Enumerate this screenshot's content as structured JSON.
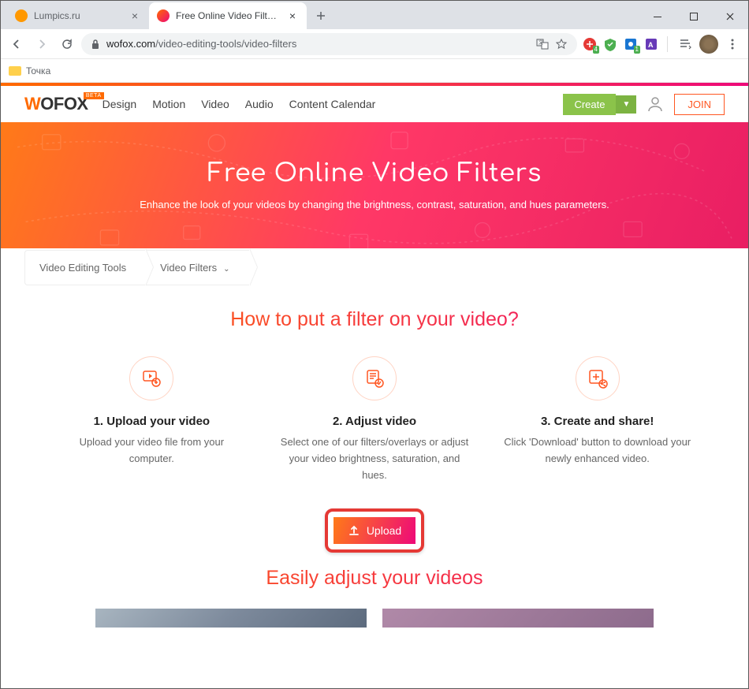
{
  "browser": {
    "tabs": [
      {
        "title": "Lumpics.ru",
        "active": false
      },
      {
        "title": "Free Online Video Filters | WoFo...",
        "active": true
      }
    ],
    "url_prefix": "wofox.com",
    "url_path": "/video-editing-tools/video-filters",
    "bookmark": "Точка"
  },
  "siteNav": {
    "logo_w": "W",
    "logo_rest": "OFOX",
    "logo_beta": "BETA",
    "items": [
      "Design",
      "Motion",
      "Video",
      "Audio",
      "Content Calendar"
    ],
    "create": "Create",
    "join": "JOIN"
  },
  "hero": {
    "title": "Free Online Video Filters",
    "subtitle": "Enhance the look of your videos by changing the brightness, contrast, saturation, and hues parameters."
  },
  "breadcrumb": {
    "items": [
      "Video Editing Tools",
      "Video Filters"
    ]
  },
  "howto": {
    "title": "How to put a filter on your video?",
    "steps": [
      {
        "title": "1. Upload your video",
        "desc": "Upload your video file from your computer."
      },
      {
        "title": "2. Adjust video",
        "desc": "Select one of our filters/overlays or adjust your video brightness, saturation, and hues."
      },
      {
        "title": "3. Create and share!",
        "desc": "Click 'Download' button to download your newly enhanced video."
      }
    ],
    "upload": "Upload"
  },
  "section2": {
    "title": "Easily adjust your videos"
  },
  "extBadges": {
    "adblock": "4",
    "ublock": "1"
  }
}
